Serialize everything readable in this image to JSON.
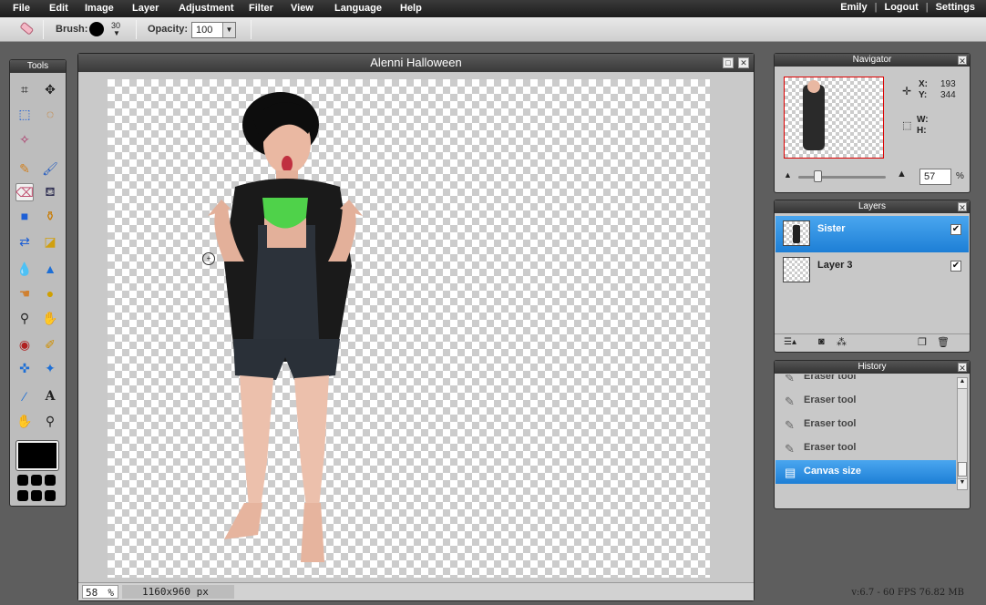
{
  "menu": [
    "File",
    "Edit",
    "Image",
    "Layer",
    "Adjustment",
    "Filter",
    "View",
    "Language",
    "Help"
  ],
  "user": {
    "name": "Emily",
    "logout": "Logout",
    "settings": "Settings",
    "separator": "|"
  },
  "options": {
    "brush_label": "Brush:",
    "brush_size": "30",
    "opacity_label": "Opacity:",
    "opacity_value": "100"
  },
  "tools": {
    "title": "Tools"
  },
  "document": {
    "title": "Alenni Halloween",
    "zoom": "58",
    "zoom_unit": "%",
    "size": "1160x960 px"
  },
  "navigator": {
    "title": "Navigator",
    "x_label": "X:",
    "x_value": "193",
    "y_label": "Y:",
    "y_value": "344",
    "w_label": "W:",
    "h_label": "H:",
    "zoom_value": "57",
    "zoom_unit": "%",
    "zoom_slider_fraction": 0.2
  },
  "layers": {
    "title": "Layers",
    "items": [
      {
        "name": "Sister",
        "visible": true
      },
      {
        "name": "Layer 3",
        "visible": true
      }
    ]
  },
  "history": {
    "title": "History",
    "items": [
      "Eraser tool",
      "Eraser tool",
      "Eraser tool",
      "Eraser tool",
      "Canvas size"
    ]
  },
  "version": "v:6.7 - 60 FPS 76.82 MB",
  "colors": {
    "accent": "#1d7fd6",
    "menubar": "#1c1c1c",
    "panel": "#c8c8c8"
  }
}
